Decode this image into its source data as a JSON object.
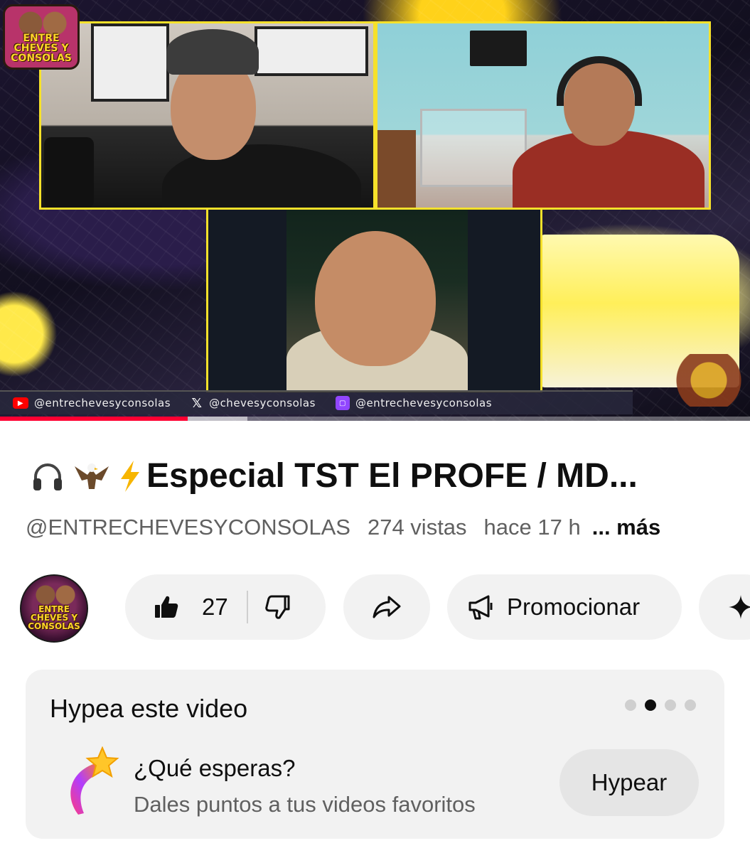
{
  "player": {
    "logo_text": "ENTRE CHEVES Y CONSOLAS",
    "social": [
      {
        "platform": "youtube",
        "icon": "youtube-icon",
        "handle": "@entrechevesyconsolas"
      },
      {
        "platform": "x",
        "icon": "x-icon",
        "handle": "@chevesyconsolas"
      },
      {
        "platform": "twitch",
        "icon": "twitch-icon",
        "handle": "@entrechevesyconsolas"
      }
    ],
    "progress_fraction": 0.25,
    "buffer_fraction": 0.33,
    "accent_color": "#ff0033",
    "frame_color": "#f6e12a"
  },
  "video": {
    "title_emojis": [
      "headphones",
      "eagle",
      "lightning"
    ],
    "title": "Especial TST El PROFE / MD...",
    "channel": "@ENTRECHEVESYCONSOLAS",
    "views": "274 vistas",
    "ago": "hace 17 h",
    "more_label": "... más"
  },
  "actions": {
    "avatar_text": "ENTRE CHEVES Y CONSOLAS",
    "like_count": "27",
    "promote_label": "Promocionar"
  },
  "hype": {
    "title": "Hypea este video",
    "question": "¿Qué esperas?",
    "subtitle": "Dales puntos a tus videos favoritos",
    "button_label": "Hypear",
    "dots_total": 4,
    "dots_active_index": 1
  }
}
